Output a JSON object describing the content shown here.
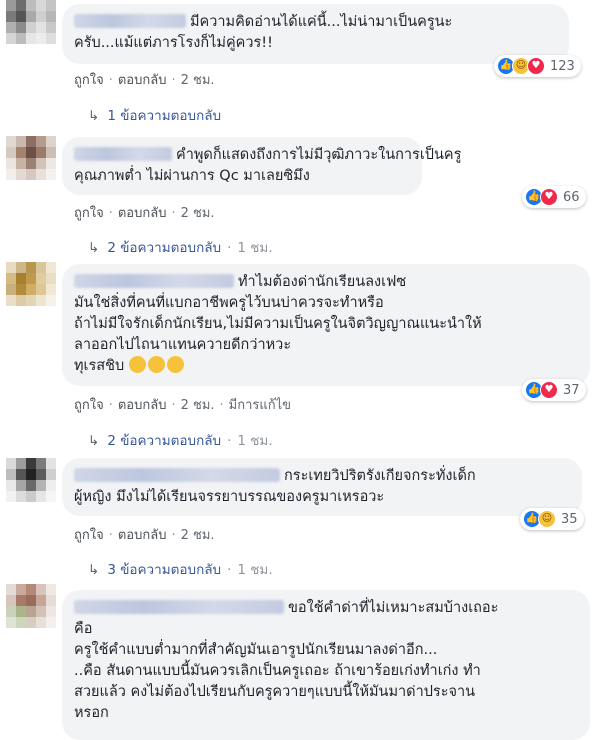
{
  "comments": [
    {
      "lines": [
        "มีความคิดอ่านได้แค่นี้...ไม่น่ามาเป็นครูนะ",
        "ครับ...แม้แต่ภารโรงก็ไม่คู่ควร!!"
      ],
      "actions": {
        "like": "ถูกใจ",
        "reply": "ตอบกลับ",
        "time": "2 ชม."
      },
      "reactions": {
        "icons": [
          "like-icon",
          "haha-icon",
          "love-icon"
        ],
        "count": "123"
      },
      "replies": {
        "label": "1 ข้อความตอบกลับ",
        "time": ""
      }
    },
    {
      "lines": [
        "คำพูดก็แสดงถึงการไม่มีวุฒิภาวะในการเป็นครู",
        "คุณภาพต่ำ ไม่ผ่านการ Qc มาเลยซิมึง"
      ],
      "actions": {
        "like": "ถูกใจ",
        "reply": "ตอบกลับ",
        "time": "2 ชม."
      },
      "reactions": {
        "icons": [
          "like-icon",
          "love-icon"
        ],
        "count": "66"
      },
      "replies": {
        "label": "2 ข้อความตอบกลับ",
        "time": "1 ชม."
      }
    },
    {
      "lines": [
        "ทำไมต้องด่านักเรียนลงเฟซ",
        "มันใช่สิ่งที่คนที่แบกอาชีพครูไว้บนบ่าควรจะทำหรือ",
        "ถ้าไม่มีใจรักเด็กนักเรียน,ไม่มีความเป็นครูในจิตวิญญาณแนะนำให้",
        "ลาออกไปไถนาแทนควายดีกว่าหวะ",
        "ทุเรสชิบ"
      ],
      "actions": {
        "like": "ถูกใจ",
        "reply": "ตอบกลับ",
        "time": "2 ชม.",
        "edited": "มีการแก้ไข"
      },
      "reactions": {
        "icons": [
          "like-icon",
          "love-icon"
        ],
        "count": "37"
      },
      "replies": {
        "label": "2 ข้อความตอบกลับ",
        "time": "1 ชม."
      }
    },
    {
      "lines": [
        "กระเทยวิปริตรังเกียจกระทั่งเด็ก",
        "ผู้หญิง มึงไม่ได้เรียนจรรยาบรรณของครูมาเหรอวะ"
      ],
      "actions": {
        "like": "ถูกใจ",
        "reply": "ตอบกลับ",
        "time": "2 ชม."
      },
      "reactions": {
        "icons": [
          "like-icon",
          "haha-icon"
        ],
        "count": "35"
      },
      "replies": {
        "label": "3 ข้อความตอบกลับ",
        "time": "1 ชม."
      }
    },
    {
      "lines": [
        "ขอใช้คำด่าที่ไม่เหมาะสมบ้างเถอะ",
        "คือ",
        "ครูใช้คำแบบต่ำมากที่สำคัญมันเอารูปนักเรียนมาลงด่าอีก...",
        "..คือ สันดานแบบนี้มันควรเลิกเป็นครูเถอะ ถ้าเขาร้อยเก่งทำเก่ง ทำ",
        "สวยแล้ว คงไม่ต้องไปเรียนกับครูควายๆแบบนี้ให้มันมาด่าประจาน",
        "หรอก"
      ]
    }
  ],
  "colors": {
    "link": "#385898",
    "bubble": "#f2f3f5",
    "meta": "#606770",
    "like": "#1877f2",
    "love": "#f0284a",
    "haha": "#f7c23b"
  }
}
